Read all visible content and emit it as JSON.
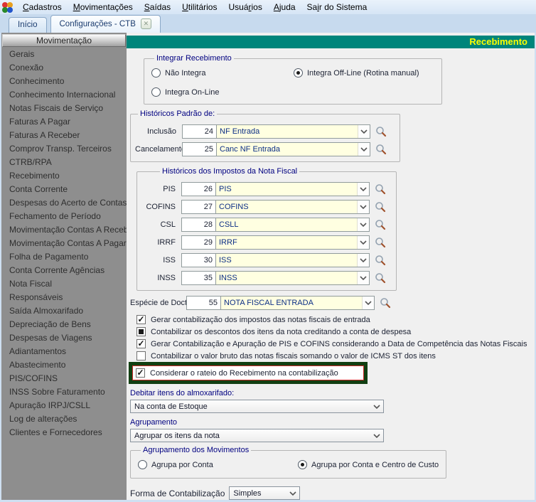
{
  "menubar": {
    "items": [
      {
        "pre": "",
        "u": "C",
        "post": "adastros"
      },
      {
        "pre": "",
        "u": "M",
        "post": "ovimentações"
      },
      {
        "pre": "",
        "u": "S",
        "post": "aídas"
      },
      {
        "pre": "",
        "u": "U",
        "post": "tilitários"
      },
      {
        "pre": "Usuá",
        "u": "r",
        "post": "ios"
      },
      {
        "pre": "",
        "u": "A",
        "post": "juda"
      },
      {
        "pre": "Sa",
        "u": "i",
        "post": "r do Sistema"
      }
    ]
  },
  "tabs": [
    {
      "label": "Início"
    },
    {
      "label": "Configurações - CTB",
      "close_icon": "x"
    }
  ],
  "sidebar": {
    "title": "Movimentação",
    "items": [
      "Gerais",
      "Conexão",
      "Conhecimento",
      "Conhecimento Internacional",
      "Notas Fiscais de Serviço",
      "Faturas A Pagar",
      "Faturas A Receber",
      "Comprov Transp. Terceiros",
      "CTRB/RPA",
      "Recebimento",
      "Conta Corrente",
      "Despesas do Acerto de Contas",
      "Fechamento de Período",
      "Movimentação Contas A Receber",
      "Movimentação Contas A Pagar",
      "Folha de Pagamento",
      "Conta Corrente Agências",
      "Nota Fiscal",
      "Responsáveis",
      "Saída Almoxarifado",
      "Depreciação de Bens",
      "Despesas de Viagens",
      "Adiantamentos",
      "Abastecimento",
      "PIS/COFINS",
      "INSS Sobre Faturamento",
      "Apuração IRPJ/CSLL",
      "Log de alterações",
      "Clientes e Fornecedores"
    ]
  },
  "main": {
    "title": "Recebimento",
    "integrar": {
      "legend": "Integrar Recebimento",
      "options": [
        {
          "label": "Não Integra",
          "selected": false
        },
        {
          "label": "Integra Off-Line (Rotina manual)",
          "selected": true
        },
        {
          "label": "Integra On-Line",
          "selected": false
        }
      ]
    },
    "historicos_padrao": {
      "legend": "Históricos Padrão de:",
      "rows": [
        {
          "label": "Inclusão",
          "code": "24",
          "value": "NF Entrada"
        },
        {
          "label": "Cancelamento",
          "code": "25",
          "value": "Canc NF Entrada"
        }
      ]
    },
    "historicos_impostos": {
      "legend": "Históricos dos Impostos da Nota Fiscal",
      "rows": [
        {
          "label": "PIS",
          "code": "26",
          "value": "PIS"
        },
        {
          "label": "COFINS",
          "code": "27",
          "value": "COFINS"
        },
        {
          "label": "CSL",
          "code": "28",
          "value": "CSLL"
        },
        {
          "label": "IRRF",
          "code": "29",
          "value": "IRRF"
        },
        {
          "label": "ISS",
          "code": "30",
          "value": "ISS"
        },
        {
          "label": "INSS",
          "code": "35",
          "value": "INSS"
        }
      ]
    },
    "especie": {
      "label": "Espécie de Docto.",
      "code": "55",
      "value": "NOTA FISCAL ENTRADA"
    },
    "checkboxes": [
      {
        "label": "Gerar contabilização dos impostos das notas fiscais de entrada",
        "state": "checked"
      },
      {
        "label": "Contabilizar os descontos dos itens da nota creditando a conta de despesa",
        "state": "mixed"
      },
      {
        "label": "Gerar Contabilização e Apuração de PIS e COFINS considerando a Data de Competência das Notas Fiscais",
        "state": "checked"
      },
      {
        "label": "Contabilizar o valor bruto das notas fiscais somando o valor de ICMS ST dos itens",
        "state": "unchecked"
      },
      {
        "label": "Considerar o rateio do Recebimento na contabilização",
        "state": "checked"
      }
    ],
    "debitar": {
      "label": "Debitar itens do almoxarifado:",
      "value": "Na conta de Estoque"
    },
    "agrupamento": {
      "label": "Agrupamento",
      "value": "Agrupar os itens da nota"
    },
    "agrup_movimentos": {
      "legend": "Agrupamento dos Movimentos",
      "options": [
        {
          "label": "Agrupa por Conta",
          "selected": false
        },
        {
          "label": "Agrupa por Conta e Centro de Custo",
          "selected": true
        }
      ]
    },
    "forma": {
      "label": "Forma de Contabilização",
      "value": "Simples"
    }
  },
  "colors": {
    "title_bar": "#00857B",
    "title_text": "#FFFF00",
    "highlight_border": "#123F12",
    "highlight_inner": "#CC2A2A",
    "combo_bg": "#FFFFE1",
    "sidebar_bg": "#8E8E8E"
  }
}
